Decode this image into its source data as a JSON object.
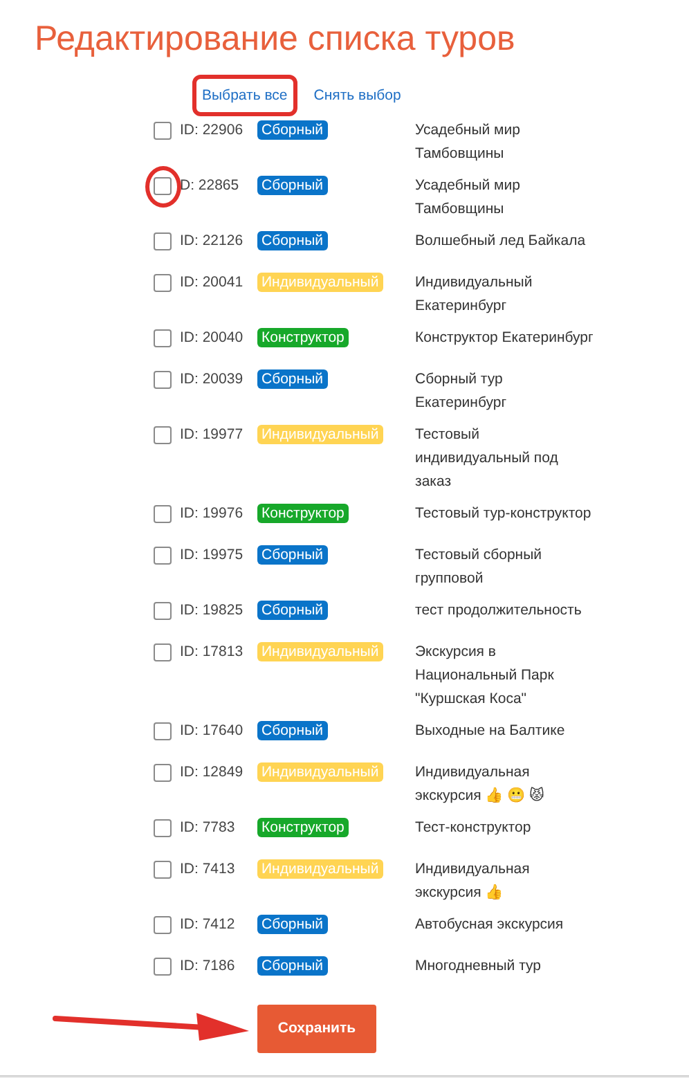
{
  "title": "Редактирование списка туров",
  "links": [
    {
      "label": "Выбрать все"
    },
    {
      "label": "Снять выбор"
    }
  ],
  "tours": [
    {
      "id": "ID: 22906",
      "kind": "group",
      "type": "Сборный",
      "name": "Усадебный мир Тамбовщины",
      "checked": false
    },
    {
      "id": "D: 22865",
      "kind": "group",
      "type": "Сборный",
      "name": "Усадебный мир Тамбовщины",
      "checked": false
    },
    {
      "id": "ID: 22126",
      "kind": "group",
      "type": "Сборный",
      "name": "Волшебный лед Байкала",
      "checked": false
    },
    {
      "id": "ID: 20041",
      "kind": "individual",
      "type": "Индивидуальный",
      "name": "Индивидуальный Екатеринбург",
      "checked": false
    },
    {
      "id": "ID: 20040",
      "kind": "builder",
      "type": "Конструктор",
      "name": "Конструктор Екатеринбург",
      "checked": false
    },
    {
      "id": "ID: 20039",
      "kind": "group",
      "type": "Сборный",
      "name": "Сборный тур Екатеринбург",
      "checked": false
    },
    {
      "id": "ID: 19977",
      "kind": "individual",
      "type": "Индивидуальный",
      "name": "Тестовый индивидуальный под заказ",
      "checked": false
    },
    {
      "id": "ID: 19976",
      "kind": "builder",
      "type": "Конструктор",
      "name": "Тестовый тур-конструктор",
      "checked": false
    },
    {
      "id": "ID: 19975",
      "kind": "group",
      "type": "Сборный",
      "name": "Тестовый сборный групповой",
      "checked": false
    },
    {
      "id": "ID: 19825",
      "kind": "group",
      "type": "Сборный",
      "name": "тест продолжительность",
      "checked": false
    },
    {
      "id": "ID: 17813",
      "kind": "individual",
      "type": "Индивидуальный",
      "name": "Экскурсия в Национальный Парк \"Куршская Коса\"",
      "checked": false
    },
    {
      "id": "ID: 17640",
      "kind": "group",
      "type": "Сборный",
      "name": "Выходные на Балтике",
      "checked": false
    },
    {
      "id": "ID: 12849",
      "kind": "individual",
      "type": "Индивидуальный",
      "name": "Индивидуальная экскурсия 👍 😬 😾",
      "checked": false
    },
    {
      "id": "ID: 7783",
      "kind": "builder",
      "type": "Конструктор",
      "name": "Тест-конструктор",
      "checked": false
    },
    {
      "id": "ID: 7413",
      "kind": "individual",
      "type": "Индивидуальный",
      "name": "Индивидуальная экскурсия 👍",
      "checked": false
    },
    {
      "id": "ID: 7412",
      "kind": "group",
      "type": "Сборный",
      "name": "Автобусная экскурсия",
      "checked": false
    },
    {
      "id": "ID: 7186",
      "kind": "group",
      "type": "Сборный",
      "name": "Многодневный тур",
      "checked": false
    }
  ],
  "save_button": "Сохранить",
  "annotations": [
    {
      "kind": "box"
    },
    {
      "kind": "circle"
    },
    {
      "kind": "arrow"
    }
  ]
}
